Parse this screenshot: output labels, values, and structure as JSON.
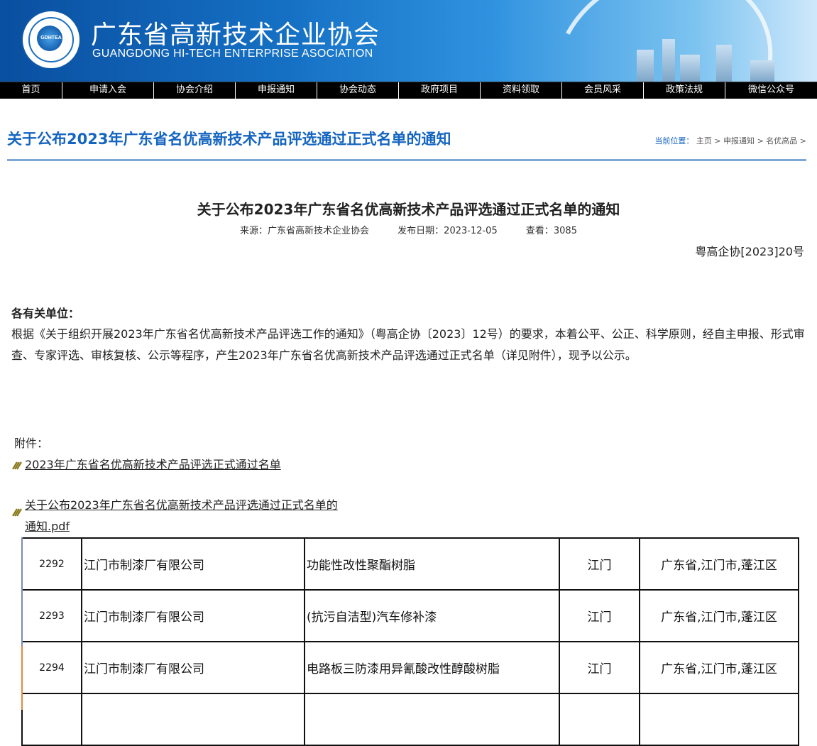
{
  "header": {
    "site_name_cn": "广东省高新技术企业协会",
    "site_name_en": "GUANGDONG HI-TECH ENTERPRISE ASOCIATION",
    "logo_text": "GDHTEA"
  },
  "nav": {
    "items": [
      "首页",
      "申请入会",
      "协会介绍",
      "申报通知",
      "协会动态",
      "政府项目",
      "资料领取",
      "会员风采",
      "政策法规",
      "微信公众号"
    ]
  },
  "page": {
    "title": "关于公布2023年广东省名优高新技术产品评选通过正式名单的通知",
    "breadcrumb": {
      "label": "当前位置：",
      "items": [
        "主页",
        "申报通知",
        "名优高品"
      ],
      "separator": ">"
    }
  },
  "article": {
    "title": "关于公布2023年广东省名优高新技术产品评选通过正式名单的通知",
    "source": "来源：广东省高新技术企业协会",
    "date": "发布日期：2023-12-05",
    "views": "查看：3085",
    "doc_no": "粤高企协[2023]20号",
    "greeting": "各有关单位：",
    "body": "根据《关于组织开展2023年广东省名优高新技术产品评选工作的通知》（粤高企协〔2023〕12号）的要求，本着公平、公正、科学原则，经自主申报、形式审查、专家评选、审核复核、公示等程序，产生2023年广东省名优高新技术产品评选通过正式名单（详见附件），现予以公示。",
    "attach_label": "附件：",
    "attachments": [
      "2023年广东省名优高新技术产品评选正式通过名单",
      "关于公布2023年广东省名优高新技术产品评选通过正式名单的通知.pdf"
    ]
  },
  "table": {
    "rows": [
      {
        "no": "2292",
        "company": "江门市制漆厂有限公司",
        "product": "功能性改性聚酯树脂",
        "city": "江门",
        "address": "广东省,江门市,蓬江区"
      },
      {
        "no": "2293",
        "company": "江门市制漆厂有限公司",
        "product": "(抗污自洁型)汽车修补漆",
        "city": "江门",
        "address": "广东省,江门市,蓬江区"
      },
      {
        "no": "2294",
        "company": "江门市制漆厂有限公司",
        "product": "电路板三防漆用异氰酸改性醇酸树脂",
        "city": "江门",
        "address": "广东省,江门市,蓬江区"
      },
      {
        "no": "",
        "company": "",
        "product": "",
        "city": "",
        "address": ""
      }
    ]
  },
  "colors": {
    "title_blue": "#1565c0",
    "nav_bg": "#000000",
    "rule": "#7ea7d8"
  }
}
